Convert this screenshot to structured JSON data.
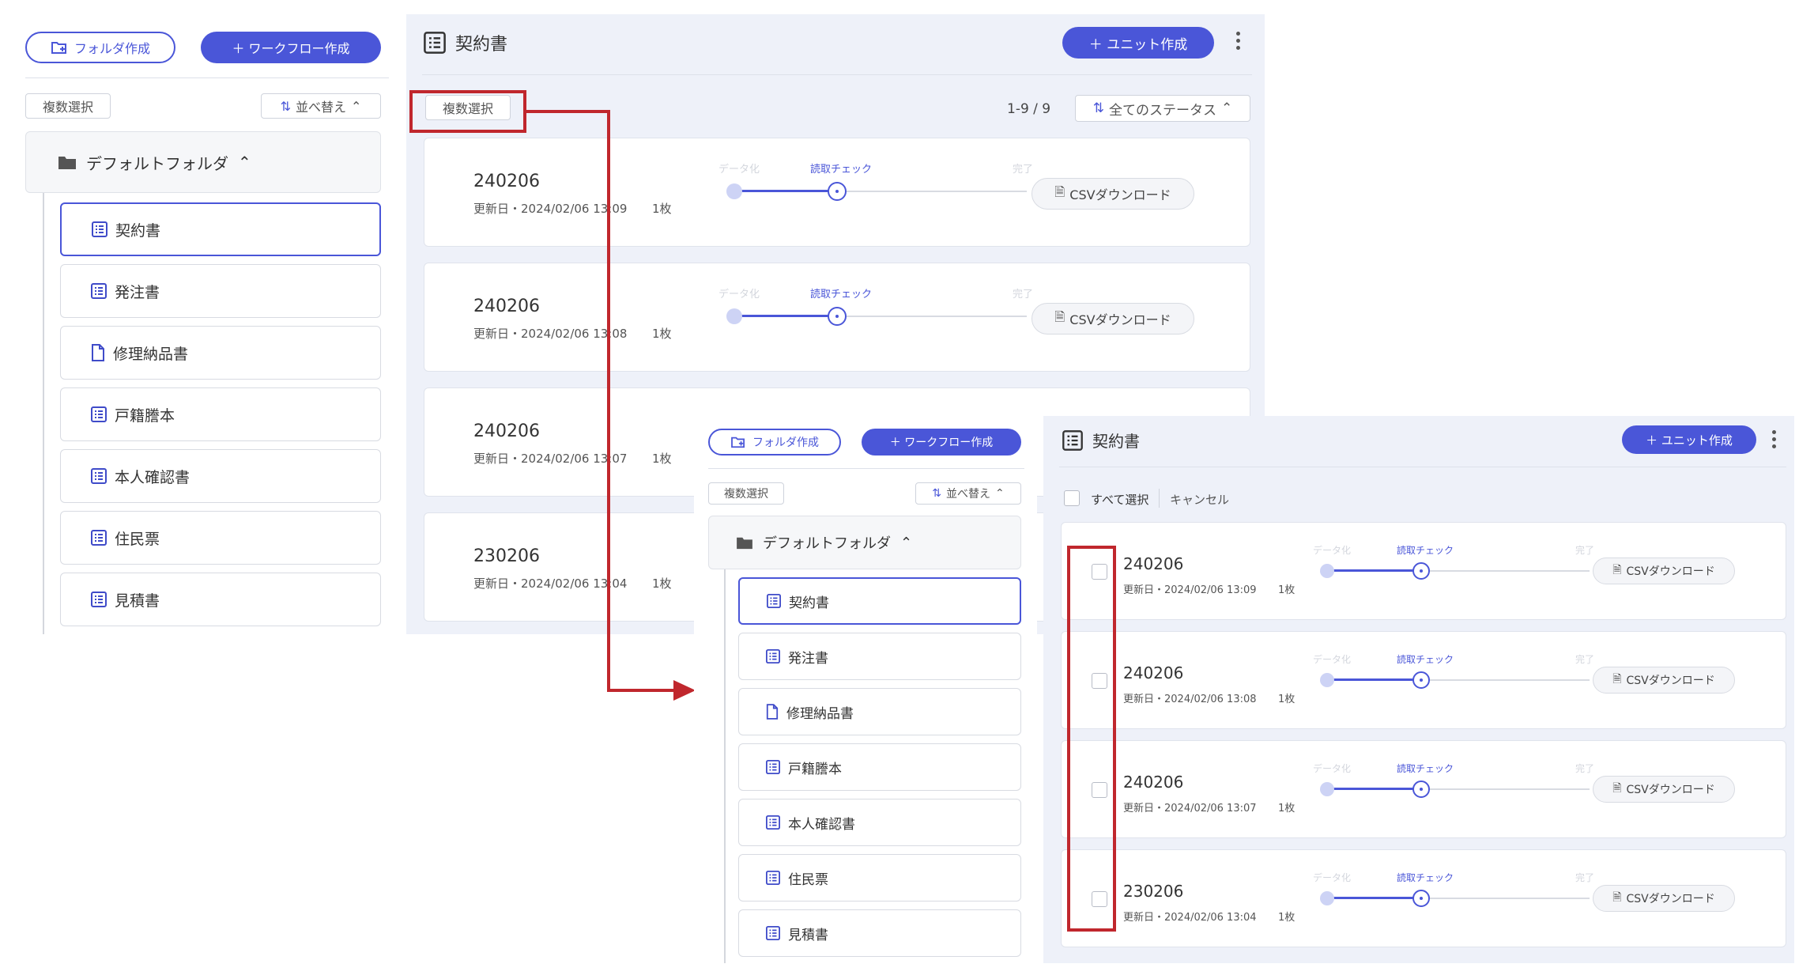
{
  "sidebar": {
    "create_folder": "フォルダ作成",
    "create_workflow": "＋ ワークフロー作成",
    "multi_select": "複数選択",
    "sort": "並べ替え",
    "folder_name": "デフォルトフォルダ",
    "items": [
      {
        "label": "契約書",
        "icon": "list-icon"
      },
      {
        "label": "発注書",
        "icon": "list-icon"
      },
      {
        "label": "修理納品書",
        "icon": "document-icon"
      },
      {
        "label": "戸籍謄本",
        "icon": "list-icon"
      },
      {
        "label": "本人確認書",
        "icon": "list-icon"
      },
      {
        "label": "住民票",
        "icon": "list-icon"
      },
      {
        "label": "見積書",
        "icon": "list-icon"
      }
    ]
  },
  "main": {
    "title": "契約書",
    "create_unit": "＋ ユニット作成",
    "multi_select": "複数選択",
    "pagination": "1-9 / 9",
    "status_filter": "全てのステータス",
    "select_all": "すべて選択",
    "cancel": "キャンセル",
    "steps": [
      "データ化",
      "読取チェック",
      "完了"
    ],
    "csv_download": "CSVダウンロード",
    "units": [
      {
        "name": "240206",
        "updated": "更新日・2024/02/06 13:09",
        "pages": "1枚"
      },
      {
        "name": "240206",
        "updated": "更新日・2024/02/06 13:08",
        "pages": "1枚"
      },
      {
        "name": "240206",
        "updated": "更新日・2024/02/06 13:07",
        "pages": "1枚"
      },
      {
        "name": "230206",
        "updated": "更新日・2024/02/06 13:04",
        "pages": "1枚"
      }
    ]
  },
  "colors": {
    "accent": "#4a56d8",
    "highlight": "#c0272d",
    "main_background": "#eef1f9"
  }
}
